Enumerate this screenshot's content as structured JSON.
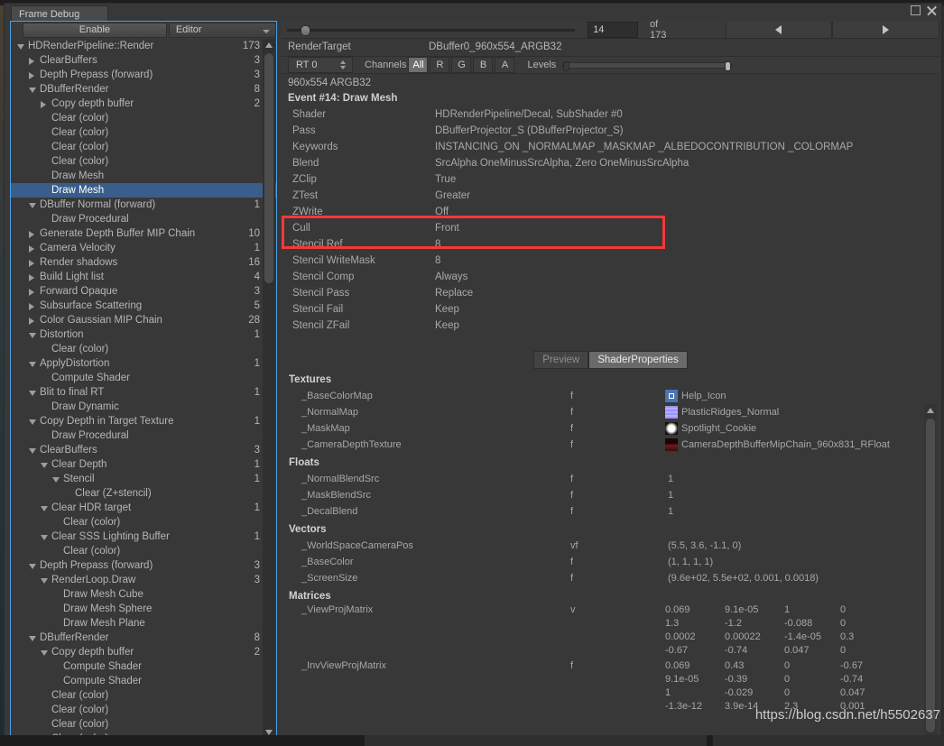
{
  "window": {
    "tab_title": "Frame Debug",
    "maximize_icon": "maximize-icon",
    "close_icon": "close-icon",
    "menu_icon": "hamburger-menu-icon"
  },
  "left_toolbar": {
    "enable_label": "Enable",
    "target_dropdown": "Editor"
  },
  "frame_bar": {
    "event_index": "14",
    "of_label": "of 173",
    "prev_icon": "previous-event-icon",
    "next_icon": "next-event-icon"
  },
  "render_target": {
    "label": "RenderTarget",
    "value": "DBuffer0_960x554_ARGB32",
    "rt_dropdown": "RT 0",
    "channels_label": "Channels",
    "channels": [
      "All",
      "R",
      "G",
      "B",
      "A"
    ],
    "channel_active": "All",
    "levels_label": "Levels",
    "format_line": "960x554 ARGB32"
  },
  "event": {
    "title": "Event #14: Draw Mesh"
  },
  "event_details": [
    {
      "key": "Shader",
      "value": "HDRenderPipeline/Decal, SubShader #0",
      "highlight": true
    },
    {
      "key": "Pass",
      "value": "DBufferProjector_S (DBufferProjector_S)",
      "highlight": true
    },
    {
      "key": "Keywords",
      "value": "INSTANCING_ON _NORMALMAP _MASKMAP _ALBEDOCONTRIBUTION _COLORMAP"
    },
    {
      "key": "Blend",
      "value": "SrcAlpha OneMinusSrcAlpha, Zero OneMinusSrcAlpha"
    },
    {
      "key": "ZClip",
      "value": "True"
    },
    {
      "key": "ZTest",
      "value": "Greater"
    },
    {
      "key": "ZWrite",
      "value": "Off"
    },
    {
      "key": "Cull",
      "value": "Front"
    },
    {
      "key": "Stencil Ref",
      "value": "8"
    },
    {
      "key": "Stencil WriteMask",
      "value": "8"
    },
    {
      "key": "Stencil Comp",
      "value": "Always"
    },
    {
      "key": "Stencil Pass",
      "value": "Replace"
    },
    {
      "key": "Stencil Fail",
      "value": "Keep"
    },
    {
      "key": "Stencil ZFail",
      "value": "Keep"
    }
  ],
  "property_tabs": {
    "items": [
      "Preview",
      "ShaderProperties"
    ],
    "active": "ShaderProperties"
  },
  "shader_properties": {
    "textures_title": "Textures",
    "textures": [
      {
        "name": "_BaseColorMap",
        "type": "f",
        "value": "Help_Icon",
        "swatch": "#4c74b4"
      },
      {
        "name": "_NormalMap",
        "type": "f",
        "value": "PlasticRidges_Normal",
        "swatch": "#8b84f0"
      },
      {
        "name": "_MaskMap",
        "type": "f",
        "value": "Spotlight_Cookie",
        "swatch": "#1a1a1a"
      },
      {
        "name": "_CameraDepthTexture",
        "type": "f",
        "value": "CameraDepthBufferMipChain_960x831_RFloat",
        "swatch": "#4a1212"
      }
    ],
    "floats_title": "Floats",
    "floats": [
      {
        "name": "_NormalBlendSrc",
        "type": "f",
        "value": "1"
      },
      {
        "name": "_MaskBlendSrc",
        "type": "f",
        "value": "1"
      },
      {
        "name": "_DecalBlend",
        "type": "f",
        "value": "1"
      }
    ],
    "vectors_title": "Vectors",
    "vectors": [
      {
        "name": "_WorldSpaceCameraPos",
        "type": "vf",
        "value": "(5.5, 3.6, -1.1, 0)"
      },
      {
        "name": "_BaseColor",
        "type": "f",
        "value": "(1, 1, 1, 1)"
      },
      {
        "name": "_ScreenSize",
        "type": "f",
        "value": "(9.6e+02, 5.5e+02, 0.001, 0.0018)"
      }
    ],
    "matrices_title": "Matrices",
    "matrices": [
      {
        "name": "_ViewProjMatrix",
        "type": "v",
        "rows": [
          [
            "0.069",
            "9.1e-05",
            "1",
            "0"
          ],
          [
            "1.3",
            "-1.2",
            "-0.088",
            "0"
          ],
          [
            "0.0002",
            "0.00022",
            "-1.4e-05",
            "0.3"
          ],
          [
            "-0.67",
            "-0.74",
            "0.047",
            "0"
          ]
        ]
      },
      {
        "name": "_InvViewProjMatrix",
        "type": "f",
        "rows": [
          [
            "0.069",
            "0.43",
            "0",
            "-0.67"
          ],
          [
            "9.1e-05",
            "-0.39",
            "0",
            "-0.74"
          ],
          [
            "1",
            "-0.029",
            "0",
            "0.047"
          ],
          [
            "-1.3e-12",
            "3.9e-14",
            "2.3",
            "0.001"
          ]
        ]
      }
    ]
  },
  "tree": {
    "items": [
      {
        "label": "HDRenderPipeline::Render",
        "depth": 0,
        "arrow": "open",
        "count": "173"
      },
      {
        "label": "ClearBuffers",
        "depth": 1,
        "arrow": "closed",
        "count": "3"
      },
      {
        "label": "Depth Prepass (forward)",
        "depth": 1,
        "arrow": "closed",
        "count": "3"
      },
      {
        "label": "DBufferRender",
        "depth": 1,
        "arrow": "open",
        "count": "8"
      },
      {
        "label": "Copy depth buffer",
        "depth": 2,
        "arrow": "closed",
        "count": "2"
      },
      {
        "label": "Clear (color)",
        "depth": 2,
        "arrow": "none",
        "count": ""
      },
      {
        "label": "Clear (color)",
        "depth": 2,
        "arrow": "none",
        "count": ""
      },
      {
        "label": "Clear (color)",
        "depth": 2,
        "arrow": "none",
        "count": ""
      },
      {
        "label": "Clear (color)",
        "depth": 2,
        "arrow": "none",
        "count": ""
      },
      {
        "label": "Draw Mesh",
        "depth": 2,
        "arrow": "none",
        "count": ""
      },
      {
        "label": "Draw Mesh",
        "depth": 2,
        "arrow": "none",
        "count": "",
        "selected": true
      },
      {
        "label": "DBuffer Normal (forward)",
        "depth": 1,
        "arrow": "open",
        "count": "1"
      },
      {
        "label": "Draw Procedural",
        "depth": 2,
        "arrow": "none",
        "count": ""
      },
      {
        "label": "Generate Depth Buffer MIP Chain",
        "depth": 1,
        "arrow": "closed",
        "count": "10"
      },
      {
        "label": "Camera Velocity",
        "depth": 1,
        "arrow": "closed",
        "count": "1"
      },
      {
        "label": "Render shadows",
        "depth": 1,
        "arrow": "closed",
        "count": "16"
      },
      {
        "label": "Build Light list",
        "depth": 1,
        "arrow": "closed",
        "count": "4"
      },
      {
        "label": "Forward Opaque",
        "depth": 1,
        "arrow": "closed",
        "count": "3"
      },
      {
        "label": "Subsurface Scattering",
        "depth": 1,
        "arrow": "closed",
        "count": "5"
      },
      {
        "label": "Color Gaussian MIP Chain",
        "depth": 1,
        "arrow": "closed",
        "count": "28"
      },
      {
        "label": "Distortion",
        "depth": 1,
        "arrow": "open",
        "count": "1"
      },
      {
        "label": "Clear (color)",
        "depth": 2,
        "arrow": "none",
        "count": ""
      },
      {
        "label": "ApplyDistortion",
        "depth": 1,
        "arrow": "open",
        "count": "1"
      },
      {
        "label": "Compute Shader",
        "depth": 2,
        "arrow": "none",
        "count": ""
      },
      {
        "label": "Blit to final RT",
        "depth": 1,
        "arrow": "open",
        "count": "1"
      },
      {
        "label": "Draw Dynamic",
        "depth": 2,
        "arrow": "none",
        "count": ""
      },
      {
        "label": "Copy Depth in Target Texture",
        "depth": 1,
        "arrow": "open",
        "count": "1"
      },
      {
        "label": "Draw Procedural",
        "depth": 2,
        "arrow": "none",
        "count": ""
      },
      {
        "label": "ClearBuffers",
        "depth": 1,
        "arrow": "open",
        "count": "3"
      },
      {
        "label": "Clear Depth",
        "depth": 2,
        "arrow": "open",
        "count": "1"
      },
      {
        "label": "Stencil",
        "depth": 3,
        "arrow": "open",
        "count": "1"
      },
      {
        "label": "Clear (Z+stencil)",
        "depth": 4,
        "arrow": "none",
        "count": ""
      },
      {
        "label": "Clear HDR target",
        "depth": 2,
        "arrow": "open",
        "count": "1"
      },
      {
        "label": "Clear (color)",
        "depth": 3,
        "arrow": "none",
        "count": ""
      },
      {
        "label": "Clear SSS Lighting Buffer",
        "depth": 2,
        "arrow": "open",
        "count": "1"
      },
      {
        "label": "Clear (color)",
        "depth": 3,
        "arrow": "none",
        "count": ""
      },
      {
        "label": "Depth Prepass (forward)",
        "depth": 1,
        "arrow": "open",
        "count": "3"
      },
      {
        "label": "RenderLoop.Draw",
        "depth": 2,
        "arrow": "open",
        "count": "3"
      },
      {
        "label": "Draw Mesh Cube",
        "depth": 3,
        "arrow": "none",
        "count": ""
      },
      {
        "label": "Draw Mesh Sphere",
        "depth": 3,
        "arrow": "none",
        "count": ""
      },
      {
        "label": "Draw Mesh Plane",
        "depth": 3,
        "arrow": "none",
        "count": ""
      },
      {
        "label": "DBufferRender",
        "depth": 1,
        "arrow": "open",
        "count": "8"
      },
      {
        "label": "Copy depth buffer",
        "depth": 2,
        "arrow": "open",
        "count": "2"
      },
      {
        "label": "Compute Shader",
        "depth": 3,
        "arrow": "none",
        "count": ""
      },
      {
        "label": "Compute Shader",
        "depth": 3,
        "arrow": "none",
        "count": ""
      },
      {
        "label": "Clear (color)",
        "depth": 2,
        "arrow": "none",
        "count": ""
      },
      {
        "label": "Clear (color)",
        "depth": 2,
        "arrow": "none",
        "count": ""
      },
      {
        "label": "Clear (color)",
        "depth": 2,
        "arrow": "none",
        "count": ""
      },
      {
        "label": "Clear (color)",
        "depth": 2,
        "arrow": "none",
        "count": ""
      }
    ]
  },
  "watermark": "https://blog.csdn.net/h5502637"
}
